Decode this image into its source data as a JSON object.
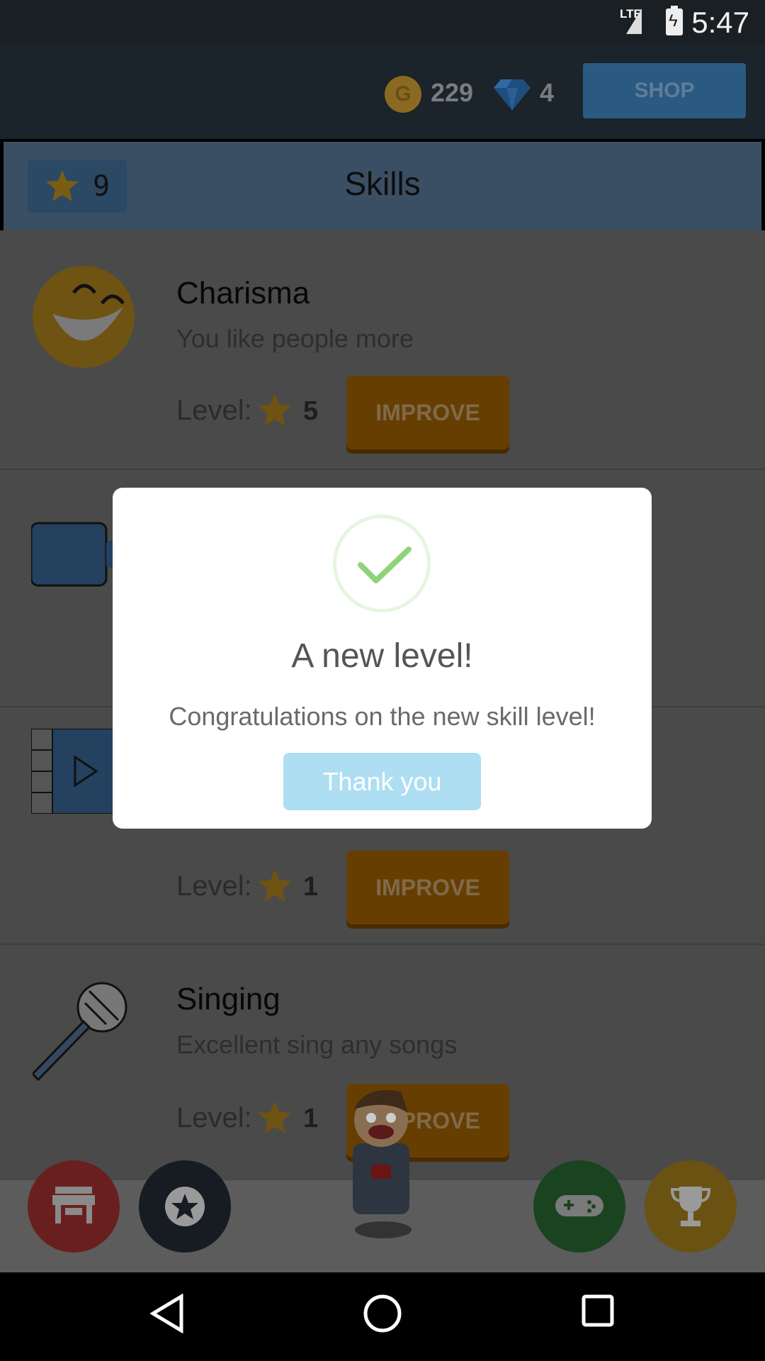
{
  "status_bar": {
    "time": "5:47",
    "network": "LTE"
  },
  "top_bar": {
    "coins": "229",
    "gems": "4",
    "shop_label": "SHOP"
  },
  "skills_header": {
    "stars": "9",
    "title": "Skills"
  },
  "skills": [
    {
      "name": "Charisma",
      "description": "You like people more",
      "level_label": "Level:",
      "level": "5",
      "button": "IMPROVE",
      "icon": "laughing-face-icon"
    },
    {
      "name": "",
      "description": "",
      "level_label": "",
      "level": "",
      "button": "",
      "icon": "video-camera-icon"
    },
    {
      "name": "",
      "description": "",
      "level_label": "Level:",
      "level": "1",
      "button": "IMPROVE",
      "icon": "film-play-icon"
    },
    {
      "name": "Singing",
      "description": "Excellent sing any songs",
      "level_label": "Level:",
      "level": "1",
      "button": "IMPROVE",
      "icon": "microphone-icon"
    }
  ],
  "bottom_nav": {
    "items": [
      "store-icon",
      "star-icon",
      "gamepad-icon",
      "trophy-icon"
    ]
  },
  "dialog": {
    "title": "A new level!",
    "message": "Congratulations on the new skill level!",
    "button": "Thank you"
  },
  "colors": {
    "improve": "#d17d04",
    "shop": "#4a90c8",
    "confirm": "#aedef2",
    "check": "#8fd47a"
  }
}
